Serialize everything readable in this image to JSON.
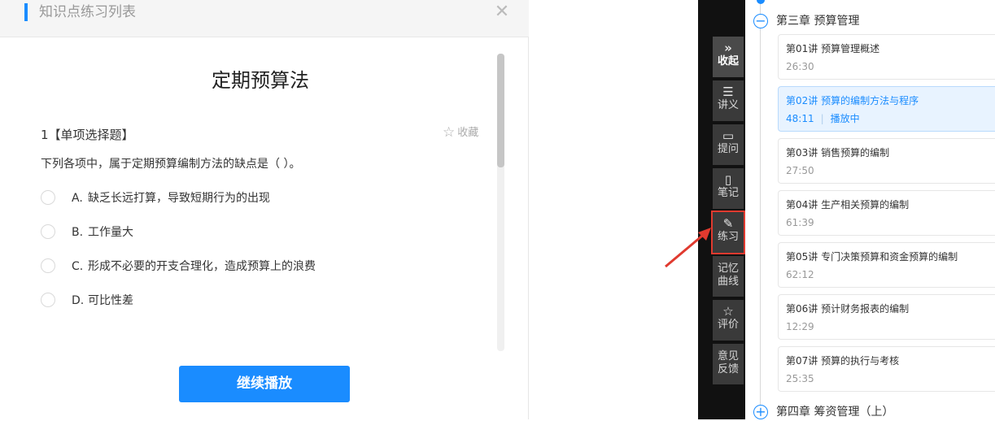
{
  "panel": {
    "title": "知识点练习列表",
    "close_glyph": "✕",
    "quiz_title": "定期预算法",
    "question": {
      "number": "1【单项选择题】",
      "favorite_label": "收藏",
      "text": "下列各项中，属于定期预算编制方法的缺点是（   ）。",
      "options": [
        {
          "letter": "A.",
          "text": "缺乏长远打算，导致短期行为的出现"
        },
        {
          "letter": "B.",
          "text": "工作量大"
        },
        {
          "letter": "C.",
          "text": "形成不必要的开支合理化，造成预算上的浪费"
        },
        {
          "letter": "D.",
          "text": "可比性差"
        }
      ]
    },
    "continue_label": "继续播放"
  },
  "toolbar": {
    "items": [
      {
        "icon": "»",
        "label": "收起"
      },
      {
        "icon": "☰",
        "label": "讲义"
      },
      {
        "icon": "▭",
        "label": "提问"
      },
      {
        "icon": "▯",
        "label": "笔记"
      },
      {
        "icon": "✎",
        "label": "练习"
      },
      {
        "icon": "",
        "label": "记忆曲线"
      },
      {
        "icon": "☆",
        "label": "评价"
      },
      {
        "icon": "",
        "label": "意见反馈"
      }
    ]
  },
  "outline": {
    "chapters": [
      {
        "icon": "−",
        "name": "第三章    预算管理"
      },
      {
        "icon": "+",
        "name": "第四章    筹资管理（上）"
      }
    ],
    "lessons": [
      {
        "title": "第01讲    预算管理概述",
        "duration": "26:30",
        "status": ""
      },
      {
        "title": "第02讲    预算的编制方法与程序",
        "duration": "48:11",
        "status": "播放中"
      },
      {
        "title": "第03讲    销售预算的编制",
        "duration": "27:50",
        "status": ""
      },
      {
        "title": "第04讲    生产相关预算的编制",
        "duration": "61:39",
        "status": ""
      },
      {
        "title": "第05讲    专门决策预算和资金预算的编制",
        "duration": "62:12",
        "status": ""
      },
      {
        "title": "第06讲    预计财务报表的编制",
        "duration": "12:29",
        "status": ""
      },
      {
        "title": "第07讲    预算的执行与考核",
        "duration": "25:35",
        "status": ""
      }
    ]
  },
  "colors": {
    "accent": "#1a8cff",
    "highlight": "#e03a2f",
    "sidebar": "#3a3a3a"
  }
}
